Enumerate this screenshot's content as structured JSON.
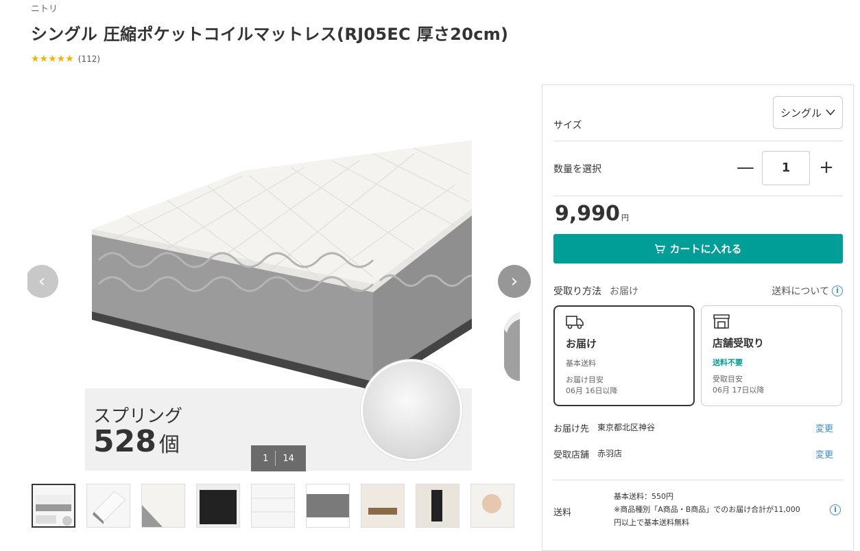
{
  "brand": "ニトリ",
  "title": "シングル 圧縮ポケットコイルマットレス(RJ05EC 厚さ20cm)",
  "rating": {
    "stars": "★★★★★",
    "value": 4.5,
    "count": "(112)"
  },
  "gallery": {
    "spec_line1": "スプリング",
    "spec_number": "528",
    "spec_unit": "個",
    "counter_current": "1",
    "counter_total": "14",
    "prev_glyph": "‹",
    "next_glyph": "›",
    "thumbnail_count": 9
  },
  "options": {
    "size_label": "サイズ",
    "size_value": "シングル",
    "qty_label": "数量を選択",
    "qty_value": "1",
    "qty_minus": "—",
    "qty_plus": "+"
  },
  "price": {
    "value": "9,990",
    "unit": "円"
  },
  "cart_button": "カートに入れる",
  "receive": {
    "label": "受取り方法",
    "value": "お届け",
    "shipping_link": "送料について"
  },
  "cards": {
    "deliver": {
      "title": "お届け",
      "sub": "基本送料",
      "eta_label": "お届け目安",
      "eta_date": "06月 16日以降"
    },
    "store": {
      "title": "店舗受取り",
      "sub": "送料不要",
      "eta_label": "受取目安",
      "eta_date": "06月 17日以降"
    }
  },
  "delivery_to": {
    "label": "お届け先",
    "value": "東京都北区神谷",
    "change": "変更"
  },
  "pickup_store": {
    "label": "受取店舗",
    "value": "赤羽店",
    "change": "変更"
  },
  "shipping": {
    "label": "送料",
    "line1": "基本送料：550円",
    "line2": "※商品種別「A商品・B商品」でのお届け合計が11,000",
    "line3": "円以上で基本送料無料"
  },
  "colors": {
    "accent": "#009e96",
    "link": "#3b8bd6",
    "star": "#f5b301"
  }
}
